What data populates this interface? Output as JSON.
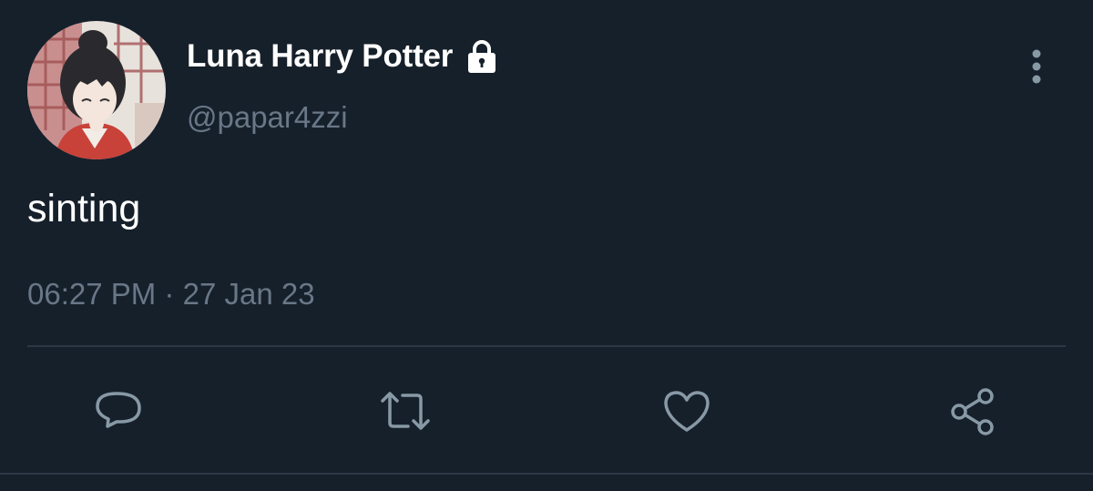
{
  "tweet": {
    "display_name": "Luna Harry Potter",
    "handle": "@papar4zzi",
    "text": "sinting",
    "time": "06:27 PM",
    "separator": "·",
    "date": "27 Jan 23"
  },
  "icons": {
    "lock": "lock-icon",
    "more": "more-vertical-icon",
    "reply": "reply-icon",
    "retweet": "retweet-icon",
    "like": "heart-icon",
    "share": "share-icon"
  },
  "colors": {
    "background": "#16202b",
    "primary_text": "#ffffff",
    "secondary_text": "#697787",
    "divider": "#2d3844",
    "icon": "#8899a6"
  }
}
